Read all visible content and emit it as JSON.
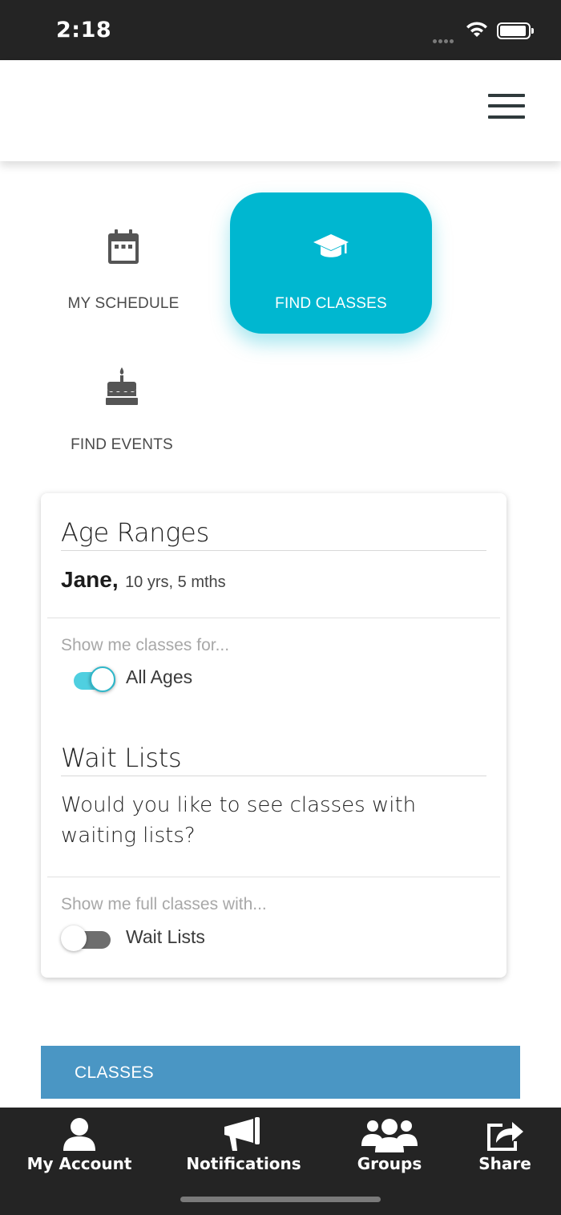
{
  "status_bar": {
    "time": "2:18"
  },
  "nav": {
    "my_schedule": "MY SCHEDULE",
    "find_classes": "FIND CLASSES",
    "find_events": "FIND EVENTS"
  },
  "filters": {
    "age_ranges": {
      "title": "Age Ranges",
      "child_name": "Jane,",
      "child_age": "10 yrs, 5 mths",
      "hint": "Show me classes for...",
      "toggle_label": "All Ages",
      "toggle_on": true
    },
    "wait_lists": {
      "title": "Wait Lists",
      "question": "Would you like to see classes with waiting lists?",
      "hint": "Show me full classes with...",
      "toggle_label": "Wait Lists",
      "toggle_on": false
    }
  },
  "classes_section": {
    "label": "CLASSES"
  },
  "tab_bar": [
    {
      "label": "My Account",
      "icon": "person-icon"
    },
    {
      "label": "Notifications",
      "icon": "megaphone-icon"
    },
    {
      "label": "Groups",
      "icon": "group-icon"
    },
    {
      "label": "Share",
      "icon": "share-icon"
    }
  ],
  "colors": {
    "accent": "#00b7d0",
    "toggle_on": "#4fcfe0",
    "classes_bar": "#4a96c4",
    "bars": "#242424"
  }
}
